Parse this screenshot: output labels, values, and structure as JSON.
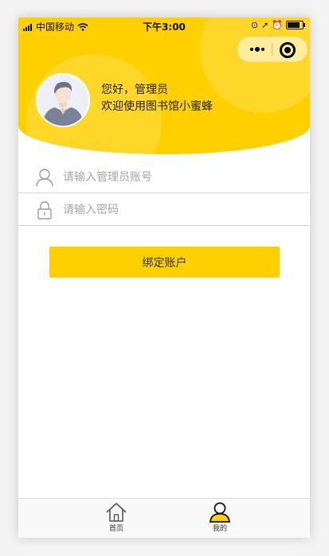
{
  "status_bar": {
    "carrier": "中国移动",
    "time": "下午3:00"
  },
  "profile": {
    "greeting": "您好，管理员",
    "welcome": "欢迎使用图书馆小蜜蜂"
  },
  "form": {
    "account_placeholder": "请输入管理员账号",
    "password_placeholder": "请输入密码",
    "submit_label": "绑定账户"
  },
  "tabbar": {
    "tabs": [
      {
        "label": "首页",
        "icon": "home-icon",
        "active": false
      },
      {
        "label": "我的",
        "icon": "user-icon",
        "active": true
      }
    ]
  },
  "colors": {
    "accent": "#ffd000",
    "placeholder": "#a6a6a6",
    "divider": "#d6d6d6"
  }
}
